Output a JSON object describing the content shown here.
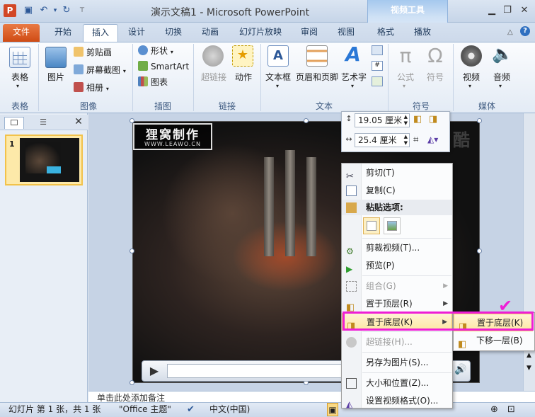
{
  "window": {
    "title": "演示文稿1 - Microsoft PowerPoint",
    "context_tools_label": "视频工具"
  },
  "tabs": {
    "file": "文件",
    "home": "开始",
    "insert": "插入",
    "design": "设计",
    "transitions": "切换",
    "animations": "动画",
    "slideshow": "幻灯片放映",
    "review": "审阅",
    "view": "视图",
    "format": "格式",
    "playback": "播放"
  },
  "ribbon": {
    "table": {
      "label": "表格",
      "group": "表格"
    },
    "image_group": {
      "picture": "图片",
      "clipart": "剪贴画",
      "screenshot": "屏幕截图",
      "album": "相册",
      "group": "图像"
    },
    "illustration_group": {
      "shapes": "形状",
      "smartart": "SmartArt",
      "chart": "图表",
      "group": "插图"
    },
    "link_group": {
      "hyperlink": "超链接",
      "action": "动作",
      "group": "链接"
    },
    "text_group": {
      "textbox": "文本框",
      "header_footer": "页眉和页脚",
      "wordart": "艺术字",
      "group": "文本"
    },
    "symbol_group": {
      "equation": "公式",
      "symbol": "符号",
      "group": "符号"
    },
    "media_group": {
      "video": "视频",
      "audio": "音频",
      "group": "媒体"
    }
  },
  "slides_pane": {
    "thumb_number": "1"
  },
  "video": {
    "watermark_title": "狸窝制作",
    "watermark_url": "WWW.LEAWO.CN",
    "side_text": "酷"
  },
  "size_toolbar": {
    "height_value": "19.05 厘米",
    "width_value": "25.4 厘米"
  },
  "context_menu": {
    "cut": "剪切(T)",
    "copy": "复制(C)",
    "paste_options": "粘贴选项:",
    "trim_video": "剪裁视频(T)...",
    "preview": "预览(P)",
    "group": "组合(G)",
    "bring_to_front": "置于顶层(R)",
    "send_to_back": "置于底层(K)",
    "hyperlink": "超链接(H)...",
    "save_as_picture": "另存为图片(S)...",
    "size_position": "大小和位置(Z)...",
    "format_video": "设置视频格式(O)..."
  },
  "submenu": {
    "send_to_back": "置于底层(K)",
    "send_backward": "下移一层(B)"
  },
  "notes": {
    "placeholder": "单击此处添加备注"
  },
  "status": {
    "slide_info": "幻灯片 第 1 张，共 1 张",
    "theme": "\"Office 主题\"",
    "language": "中文(中国)"
  }
}
